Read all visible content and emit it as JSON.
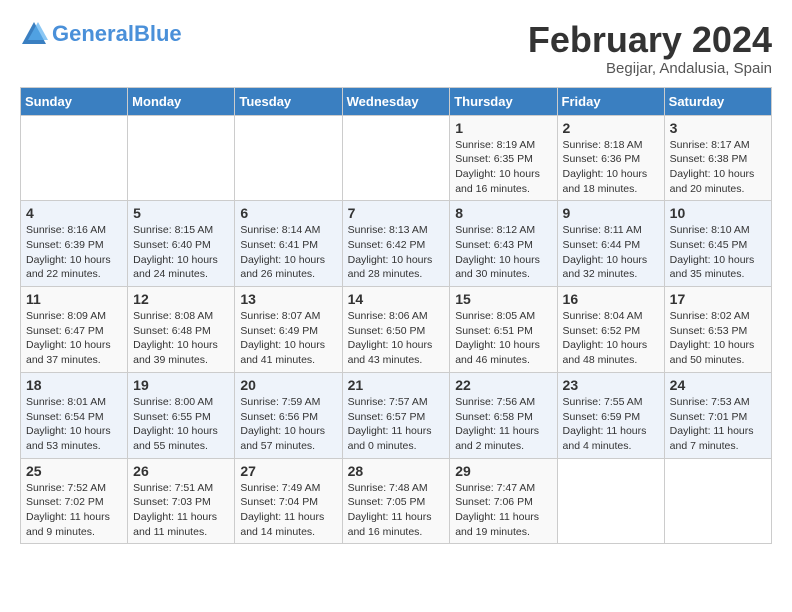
{
  "logo": {
    "text_general": "General",
    "text_blue": "Blue"
  },
  "title": "February 2024",
  "subtitle": "Begijar, Andalusia, Spain",
  "days_of_week": [
    "Sunday",
    "Monday",
    "Tuesday",
    "Wednesday",
    "Thursday",
    "Friday",
    "Saturday"
  ],
  "weeks": [
    [
      {
        "day": "",
        "info": ""
      },
      {
        "day": "",
        "info": ""
      },
      {
        "day": "",
        "info": ""
      },
      {
        "day": "",
        "info": ""
      },
      {
        "day": "1",
        "info": "Sunrise: 8:19 AM\nSunset: 6:35 PM\nDaylight: 10 hours\nand 16 minutes."
      },
      {
        "day": "2",
        "info": "Sunrise: 8:18 AM\nSunset: 6:36 PM\nDaylight: 10 hours\nand 18 minutes."
      },
      {
        "day": "3",
        "info": "Sunrise: 8:17 AM\nSunset: 6:38 PM\nDaylight: 10 hours\nand 20 minutes."
      }
    ],
    [
      {
        "day": "4",
        "info": "Sunrise: 8:16 AM\nSunset: 6:39 PM\nDaylight: 10 hours\nand 22 minutes."
      },
      {
        "day": "5",
        "info": "Sunrise: 8:15 AM\nSunset: 6:40 PM\nDaylight: 10 hours\nand 24 minutes."
      },
      {
        "day": "6",
        "info": "Sunrise: 8:14 AM\nSunset: 6:41 PM\nDaylight: 10 hours\nand 26 minutes."
      },
      {
        "day": "7",
        "info": "Sunrise: 8:13 AM\nSunset: 6:42 PM\nDaylight: 10 hours\nand 28 minutes."
      },
      {
        "day": "8",
        "info": "Sunrise: 8:12 AM\nSunset: 6:43 PM\nDaylight: 10 hours\nand 30 minutes."
      },
      {
        "day": "9",
        "info": "Sunrise: 8:11 AM\nSunset: 6:44 PM\nDaylight: 10 hours\nand 32 minutes."
      },
      {
        "day": "10",
        "info": "Sunrise: 8:10 AM\nSunset: 6:45 PM\nDaylight: 10 hours\nand 35 minutes."
      }
    ],
    [
      {
        "day": "11",
        "info": "Sunrise: 8:09 AM\nSunset: 6:47 PM\nDaylight: 10 hours\nand 37 minutes."
      },
      {
        "day": "12",
        "info": "Sunrise: 8:08 AM\nSunset: 6:48 PM\nDaylight: 10 hours\nand 39 minutes."
      },
      {
        "day": "13",
        "info": "Sunrise: 8:07 AM\nSunset: 6:49 PM\nDaylight: 10 hours\nand 41 minutes."
      },
      {
        "day": "14",
        "info": "Sunrise: 8:06 AM\nSunset: 6:50 PM\nDaylight: 10 hours\nand 43 minutes."
      },
      {
        "day": "15",
        "info": "Sunrise: 8:05 AM\nSunset: 6:51 PM\nDaylight: 10 hours\nand 46 minutes."
      },
      {
        "day": "16",
        "info": "Sunrise: 8:04 AM\nSunset: 6:52 PM\nDaylight: 10 hours\nand 48 minutes."
      },
      {
        "day": "17",
        "info": "Sunrise: 8:02 AM\nSunset: 6:53 PM\nDaylight: 10 hours\nand 50 minutes."
      }
    ],
    [
      {
        "day": "18",
        "info": "Sunrise: 8:01 AM\nSunset: 6:54 PM\nDaylight: 10 hours\nand 53 minutes."
      },
      {
        "day": "19",
        "info": "Sunrise: 8:00 AM\nSunset: 6:55 PM\nDaylight: 10 hours\nand 55 minutes."
      },
      {
        "day": "20",
        "info": "Sunrise: 7:59 AM\nSunset: 6:56 PM\nDaylight: 10 hours\nand 57 minutes."
      },
      {
        "day": "21",
        "info": "Sunrise: 7:57 AM\nSunset: 6:57 PM\nDaylight: 11 hours\nand 0 minutes."
      },
      {
        "day": "22",
        "info": "Sunrise: 7:56 AM\nSunset: 6:58 PM\nDaylight: 11 hours\nand 2 minutes."
      },
      {
        "day": "23",
        "info": "Sunrise: 7:55 AM\nSunset: 6:59 PM\nDaylight: 11 hours\nand 4 minutes."
      },
      {
        "day": "24",
        "info": "Sunrise: 7:53 AM\nSunset: 7:01 PM\nDaylight: 11 hours\nand 7 minutes."
      }
    ],
    [
      {
        "day": "25",
        "info": "Sunrise: 7:52 AM\nSunset: 7:02 PM\nDaylight: 11 hours\nand 9 minutes."
      },
      {
        "day": "26",
        "info": "Sunrise: 7:51 AM\nSunset: 7:03 PM\nDaylight: 11 hours\nand 11 minutes."
      },
      {
        "day": "27",
        "info": "Sunrise: 7:49 AM\nSunset: 7:04 PM\nDaylight: 11 hours\nand 14 minutes."
      },
      {
        "day": "28",
        "info": "Sunrise: 7:48 AM\nSunset: 7:05 PM\nDaylight: 11 hours\nand 16 minutes."
      },
      {
        "day": "29",
        "info": "Sunrise: 7:47 AM\nSunset: 7:06 PM\nDaylight: 11 hours\nand 19 minutes."
      },
      {
        "day": "",
        "info": ""
      },
      {
        "day": "",
        "info": ""
      }
    ]
  ]
}
